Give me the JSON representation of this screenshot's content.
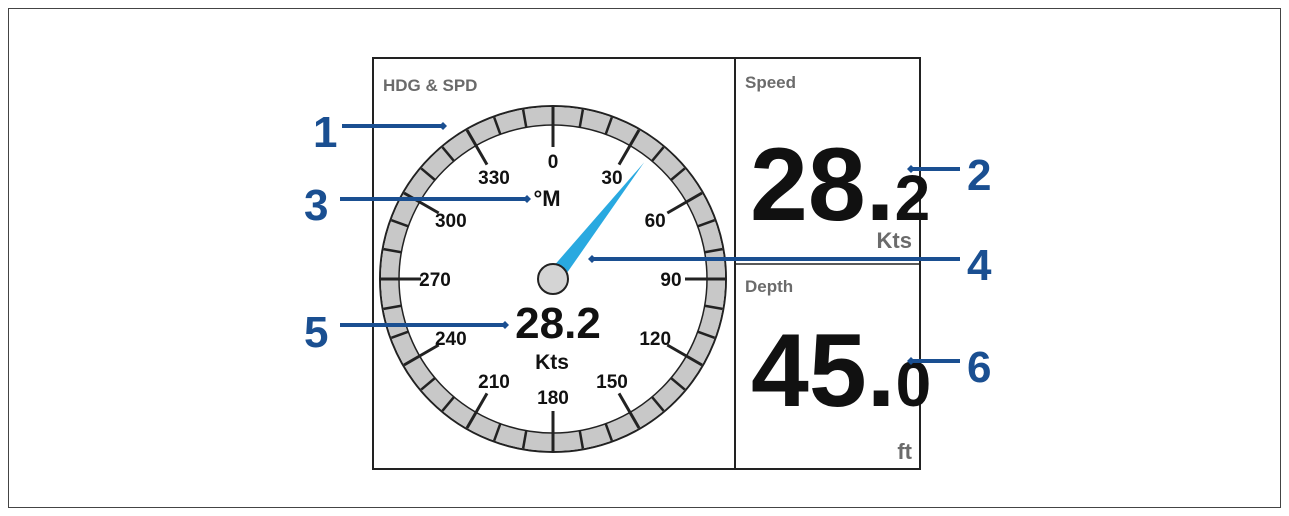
{
  "panel": {
    "title": "HDG & SPD"
  },
  "compass": {
    "tick_labels": [
      "0",
      "30",
      "60",
      "90",
      "120",
      "150",
      "180",
      "210",
      "240",
      "270",
      "300",
      "330"
    ],
    "reference": "°M",
    "heading_deg": 38,
    "speed_value": "28.2",
    "speed_unit": "Kts"
  },
  "speed_tile": {
    "title": "Speed",
    "value_main": "28.",
    "value_decimal": "2",
    "unit": "Kts"
  },
  "depth_tile": {
    "title": "Depth",
    "value_main": "45.",
    "value_decimal": "0",
    "unit": "ft"
  },
  "callouts": {
    "c1": "1",
    "c2": "2",
    "c3": "3",
    "c4": "4",
    "c5": "5",
    "c6": "6"
  },
  "colors": {
    "callout": "#1a4f91",
    "needle": "#29a9e0",
    "bezel": "#c8c8c8",
    "hub": "#d4d4d4"
  }
}
